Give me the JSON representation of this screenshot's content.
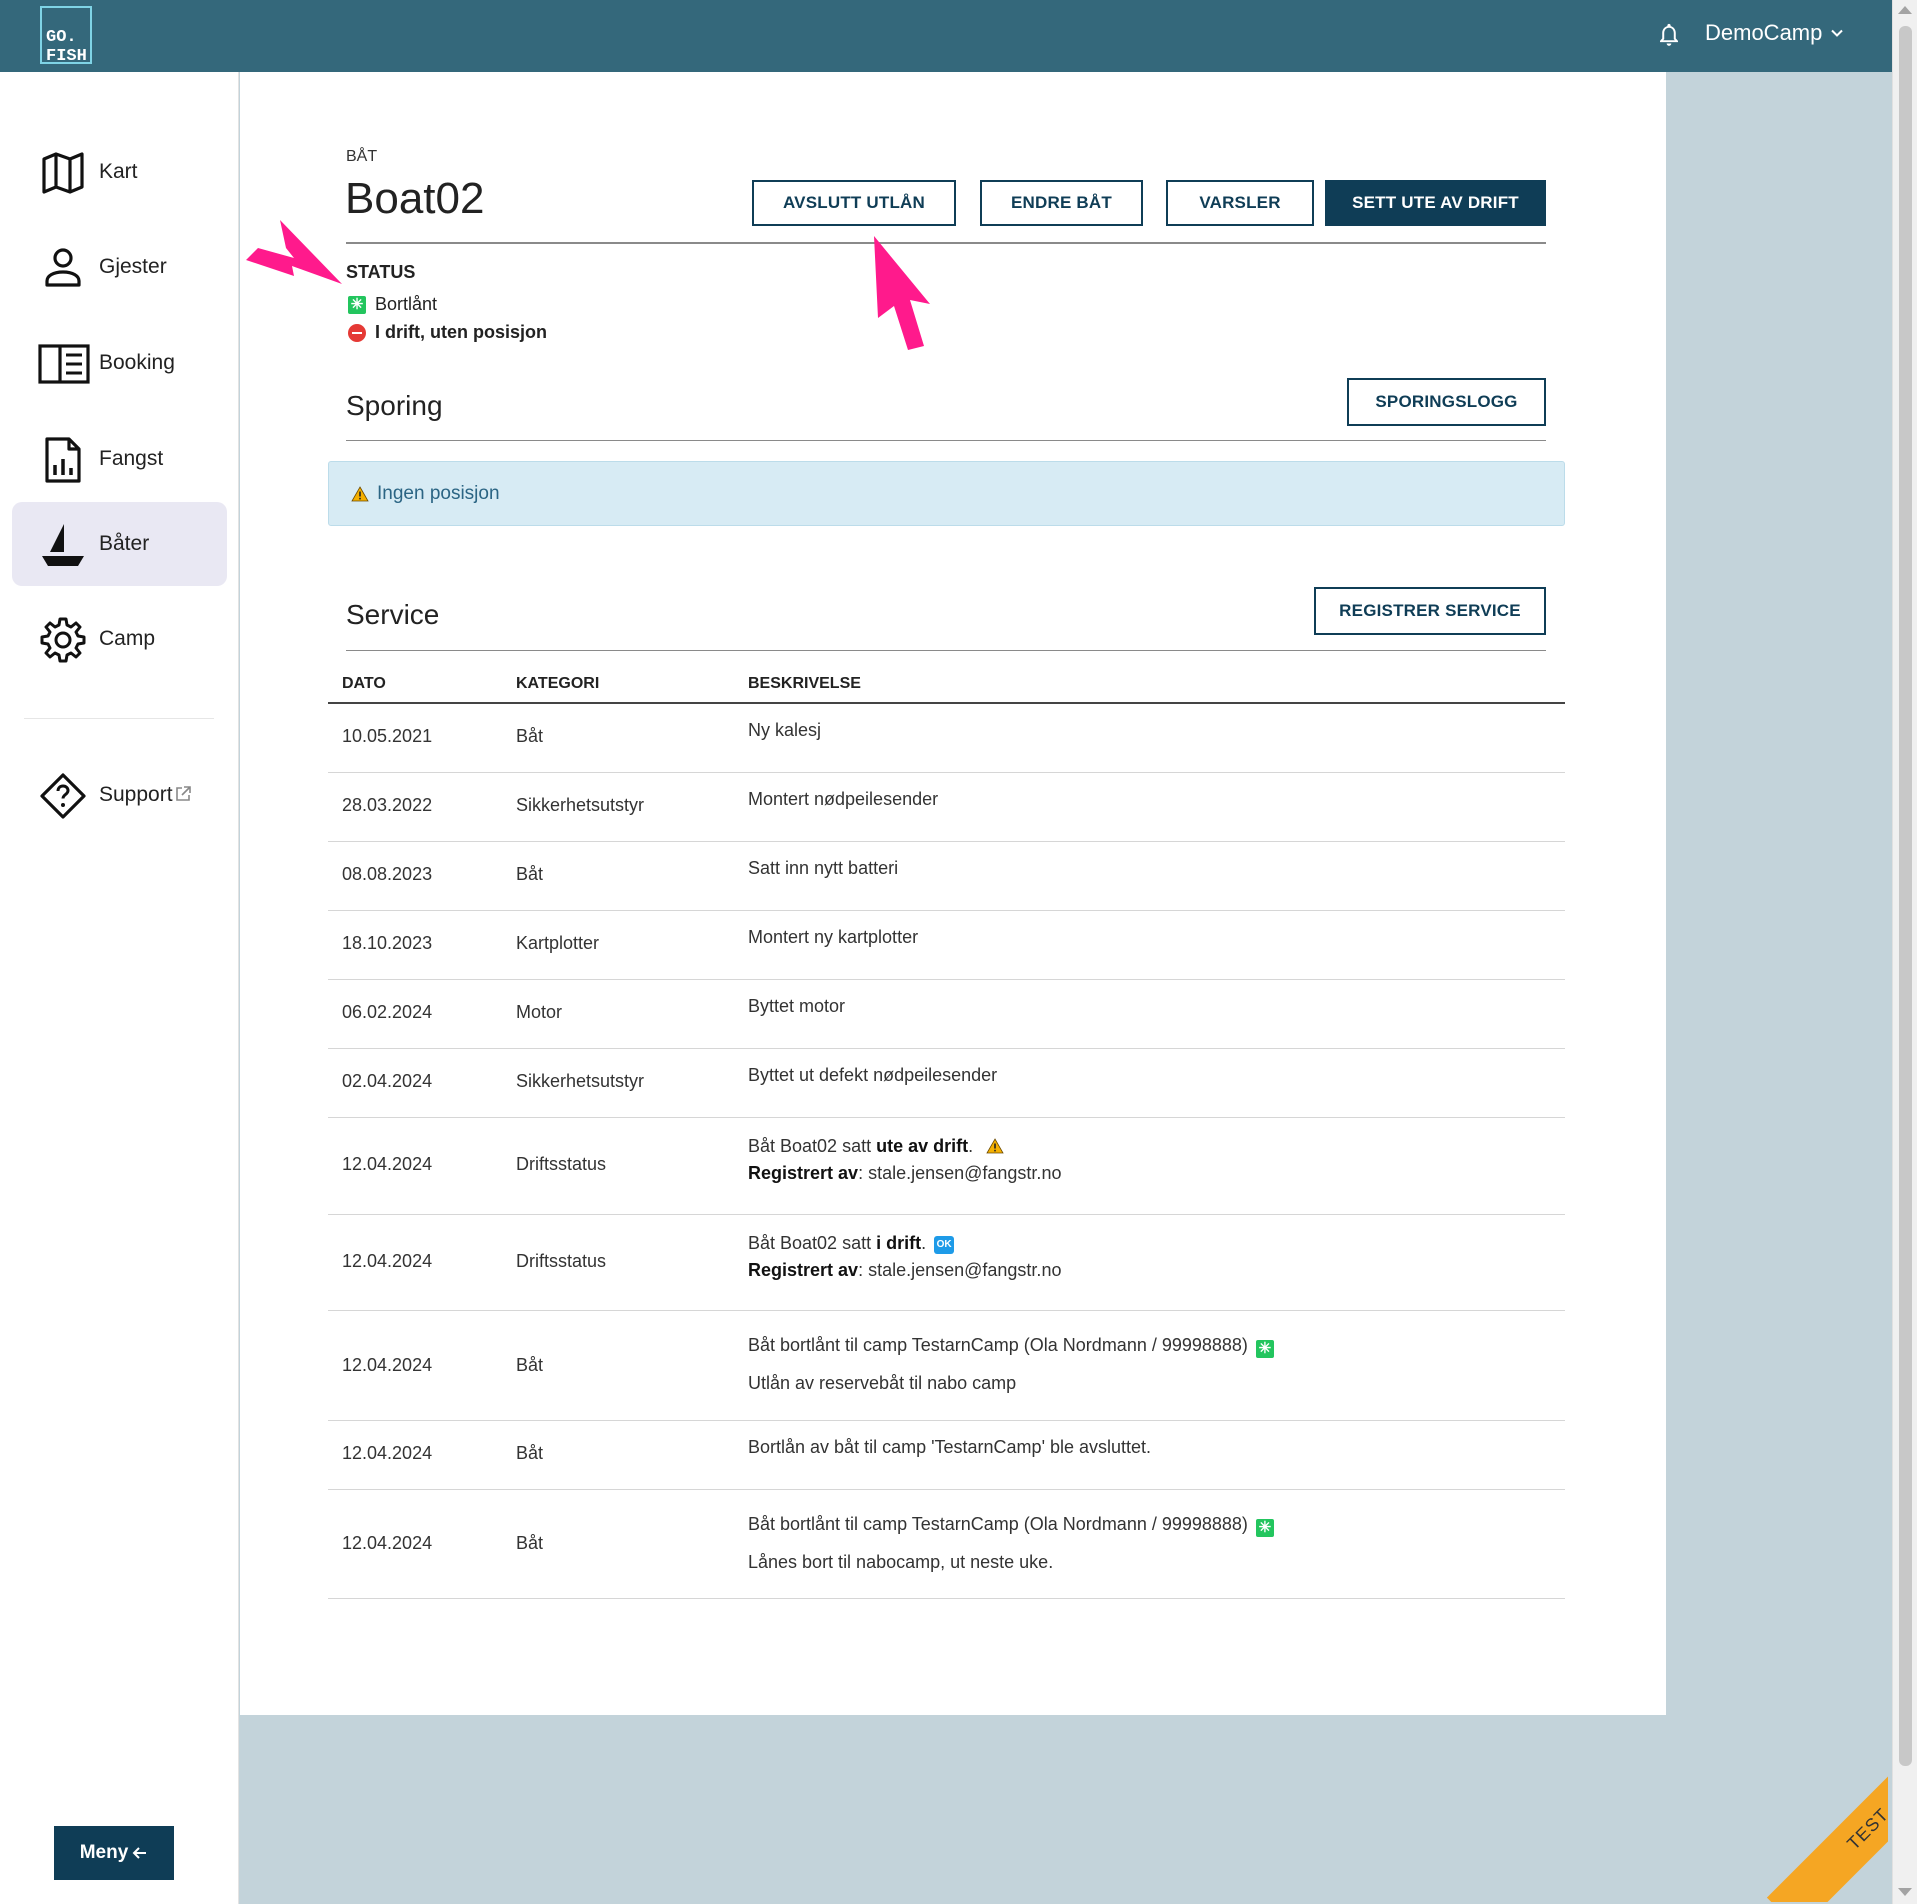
{
  "app": {
    "logo_line1": "GO.",
    "logo_line2": "FISH",
    "camp_name": "DemoCamp"
  },
  "sidebar": {
    "items": [
      {
        "label": "Kart",
        "icon": "map-icon"
      },
      {
        "label": "Gjester",
        "icon": "person-icon"
      },
      {
        "label": "Booking",
        "icon": "booking-icon"
      },
      {
        "label": "Fangst",
        "icon": "report-icon"
      },
      {
        "label": "Båter",
        "icon": "sailboat-icon",
        "active": true
      },
      {
        "label": "Camp",
        "icon": "gear-icon"
      }
    ],
    "support_label": "Support",
    "menu_label": "Meny"
  },
  "boat": {
    "eyebrow": "BÅT",
    "name": "Boat02",
    "buttons": {
      "end_loan": "AVSLUTT UTLÅN",
      "edit": "ENDRE BÅT",
      "alerts": "VARSLER",
      "decommission": "SETT UTE AV DRIFT"
    },
    "status_heading": "STATUS",
    "status": [
      {
        "text": "Bortlånt",
        "badge": "green"
      },
      {
        "text": "I drift, uten posisjon",
        "badge": "red"
      }
    ]
  },
  "tracking": {
    "title": "Sporing",
    "log_button": "SPORINGSLOGG",
    "alert": "Ingen posisjon"
  },
  "service": {
    "title": "Service",
    "register_button": "REGISTRER SERVICE",
    "columns": [
      "DATO",
      "KATEGORI",
      "BESKRIVELSE"
    ],
    "rows": [
      {
        "date": "10.05.2021",
        "category": "Båt",
        "description": "Ny kalesj"
      },
      {
        "date": "28.03.2022",
        "category": "Sikkerhetsutstyr",
        "description": "Montert nødpeilesender"
      },
      {
        "date": "08.08.2023",
        "category": "Båt",
        "description": "Satt inn nytt batteri"
      },
      {
        "date": "18.10.2023",
        "category": "Kartplotter",
        "description": "Montert ny kartplotter"
      },
      {
        "date": "06.02.2024",
        "category": "Motor",
        "description": "Byttet motor"
      },
      {
        "date": "02.04.2024",
        "category": "Sikkerhetsutstyr",
        "description": "Byttet ut defekt nødpeilesender"
      },
      {
        "date": "12.04.2024",
        "category": "Driftsstatus",
        "desc_prefix": "Båt Boat02 satt ",
        "desc_bold": "ute av drift",
        "desc_suffix": ".",
        "reg_label": "Registrert av",
        "reg_value": ": stale.jensen@fangstr.no"
      },
      {
        "date": "12.04.2024",
        "category": "Driftsstatus",
        "desc_prefix": "Båt Boat02 satt ",
        "desc_bold": "i drift",
        "desc_suffix": ".",
        "ok_badge": "OK",
        "reg_label": "Registrert av",
        "reg_value": ": stale.jensen@fangstr.no"
      },
      {
        "date": "12.04.2024",
        "category": "Båt",
        "description": "Båt bortlånt til camp TestarnCamp (Ola Nordmann / 99998888)",
        "note": "Utlån av reservebåt til nabo camp"
      },
      {
        "date": "12.04.2024",
        "category": "Båt",
        "description": "Bortlån av båt til camp 'TestarnCamp' ble avsluttet."
      },
      {
        "date": "12.04.2024",
        "category": "Båt",
        "description": "Båt bortlånt til camp TestarnCamp (Ola Nordmann / 99998888)",
        "note": "Lånes bort til nabocamp, ut neste uke."
      }
    ]
  },
  "ribbon": "TEST",
  "colors": {
    "topbar": "#34687b",
    "primary": "#0f3d56",
    "annotation": "#ff1a8c",
    "ribbon": "#f5a623",
    "status_green": "#23c55e",
    "status_red": "#e53935"
  }
}
